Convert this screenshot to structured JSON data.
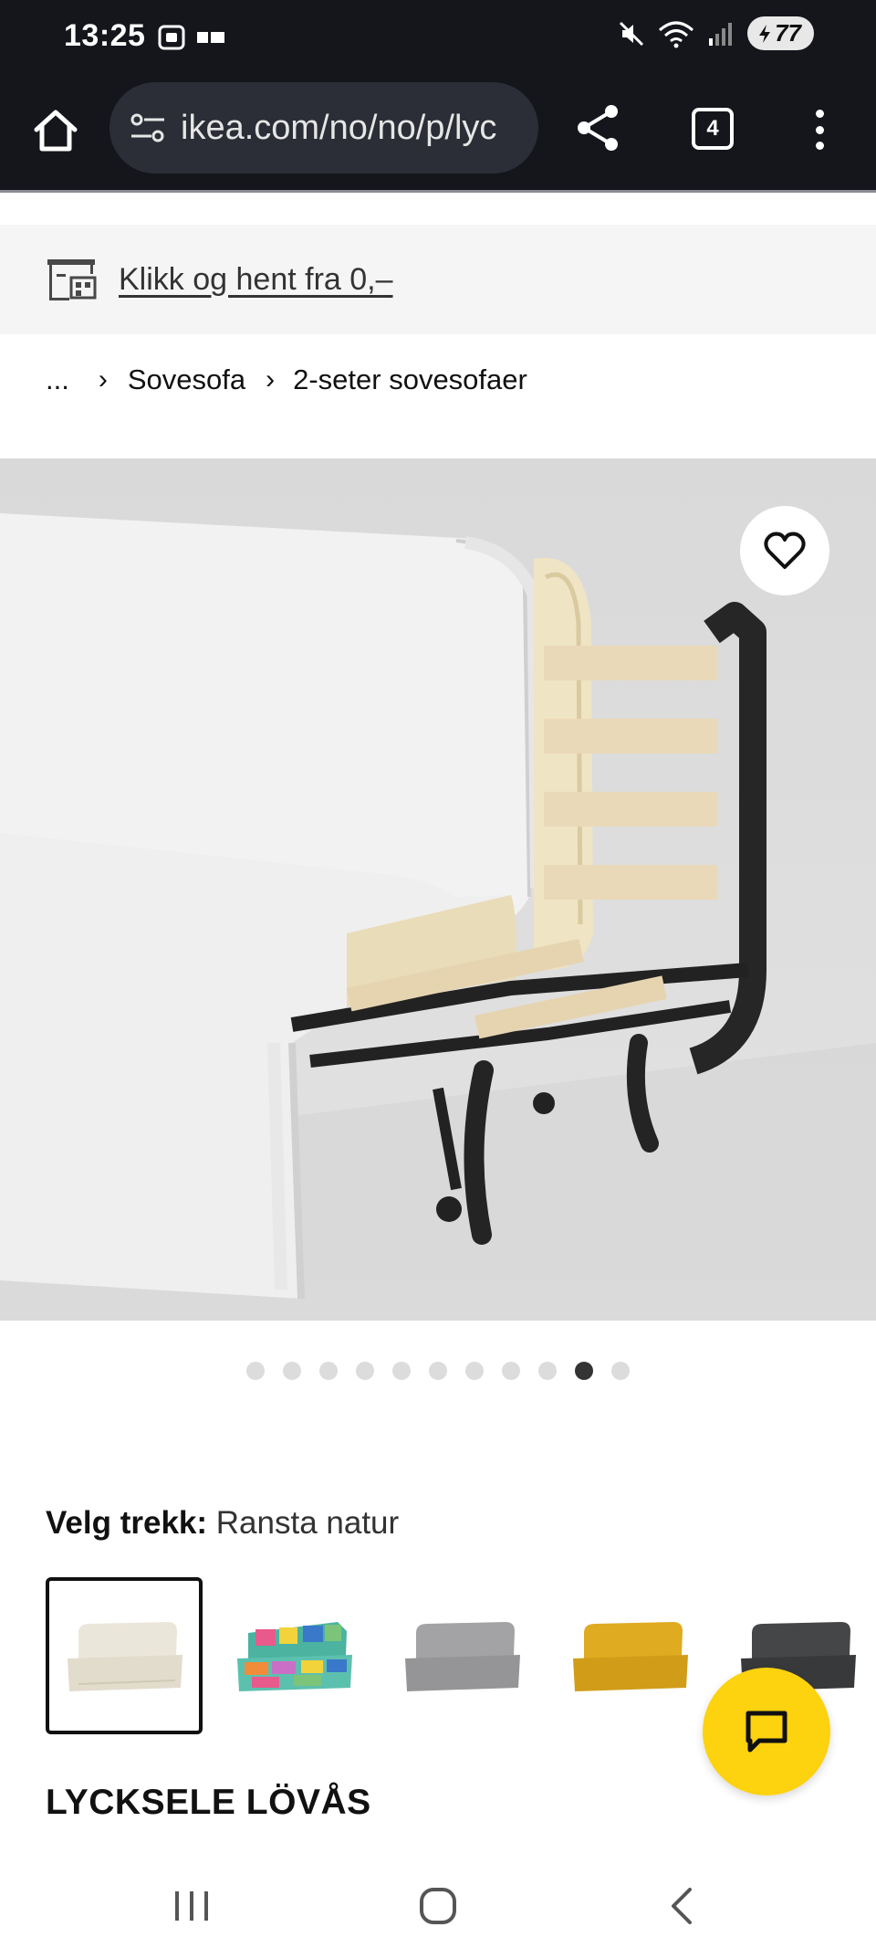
{
  "status_bar": {
    "time": "13:25",
    "battery": "77"
  },
  "browser": {
    "url": "ikea.com/no/no/p/lyc",
    "tab_count": "4"
  },
  "click_collect": {
    "label": "Klikk og hent fra 0,–"
  },
  "breadcrumb": {
    "ellipsis": "...",
    "items": [
      "Sovesofa",
      "2-seter sovesofaer"
    ]
  },
  "gallery": {
    "dot_count": 11,
    "active_index": 9
  },
  "variant": {
    "label": "Velg trekk:",
    "value": "Ransta natur",
    "swatches": [
      {
        "name": "Ransta natur",
        "color": "#ebe6da",
        "selected": true
      },
      {
        "name": "multicolour patchwork",
        "color": "#4bb3a0",
        "selected": false
      },
      {
        "name": "grey",
        "color": "#9b9b9d",
        "selected": false
      },
      {
        "name": "yellow",
        "color": "#d9a51c",
        "selected": false
      },
      {
        "name": "dark grey",
        "color": "#3e3f41",
        "selected": false
      }
    ]
  },
  "product": {
    "title": "LYCKSELE LÖVÅS"
  },
  "colors": {
    "chrome_bg": "#14161c",
    "chat_fab": "#fdd20e"
  }
}
